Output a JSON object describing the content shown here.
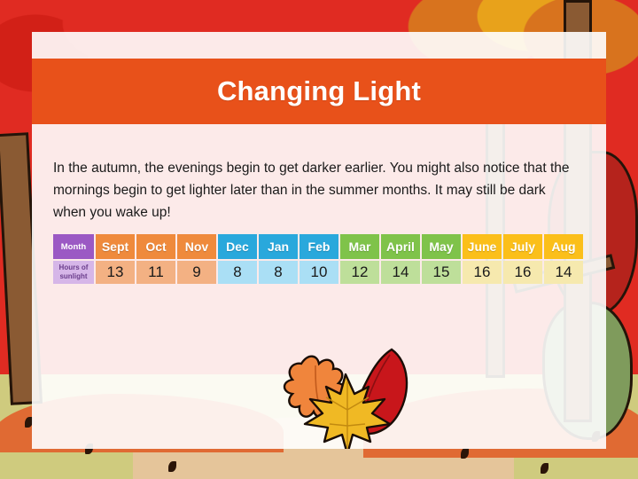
{
  "slide": {
    "title": "Changing Light",
    "body": "In the autumn, the evenings begin to get darker earlier. You might also notice that the mornings begin to get lighter later than in the summer months. It may still be dark when you wake up!"
  },
  "theme": {
    "title_bar": "#E8511A",
    "month_label_bg": "#9B59C4",
    "hours_label_bg": "#D6B6E8",
    "autumn_header": "#EF8A3C",
    "winter_header": "#29A8DC",
    "spring_header": "#7FC34A",
    "summer_header": "#FBBF1A",
    "backdrop_red": "#E02B22",
    "ground_olive": "#CFCB7E"
  },
  "table": {
    "row_labels": {
      "month": "Month",
      "hours": "Hours of sunlight"
    },
    "columns": [
      {
        "month": "Sept",
        "hours": "13",
        "season": "orange"
      },
      {
        "month": "Oct",
        "hours": "11",
        "season": "orange"
      },
      {
        "month": "Nov",
        "hours": "9",
        "season": "orange"
      },
      {
        "month": "Dec",
        "hours": "8",
        "season": "blue"
      },
      {
        "month": "Jan",
        "hours": "8",
        "season": "blue"
      },
      {
        "month": "Feb",
        "hours": "10",
        "season": "blue"
      },
      {
        "month": "Mar",
        "hours": "12",
        "season": "green"
      },
      {
        "month": "April",
        "hours": "14",
        "season": "green"
      },
      {
        "month": "May",
        "hours": "15",
        "season": "green"
      },
      {
        "month": "June",
        "hours": "16",
        "season": "yellow"
      },
      {
        "month": "July",
        "hours": "16",
        "season": "yellow"
      },
      {
        "month": "Aug",
        "hours": "14",
        "season": "yellow"
      }
    ]
  },
  "chart_data": {
    "type": "table",
    "title": "Changing Light",
    "categories": [
      "Sept",
      "Oct",
      "Nov",
      "Dec",
      "Jan",
      "Feb",
      "Mar",
      "April",
      "May",
      "June",
      "July",
      "Aug"
    ],
    "values": [
      13,
      11,
      9,
      8,
      8,
      10,
      12,
      14,
      15,
      16,
      16,
      14
    ],
    "xlabel": "Month",
    "ylabel": "Hours of sunlight",
    "ylim": [
      0,
      16
    ],
    "grid": false,
    "legend": null,
    "series": [
      {
        "name": "Hours of sunlight",
        "values": [
          13,
          11,
          9,
          8,
          8,
          10,
          12,
          14,
          15,
          16,
          16,
          14
        ]
      }
    ]
  },
  "illustration": {
    "scene": "autumn-forest-backdrop",
    "leaves": [
      "orange-oak-leaf",
      "red-leaf",
      "yellow-maple-leaf"
    ]
  }
}
